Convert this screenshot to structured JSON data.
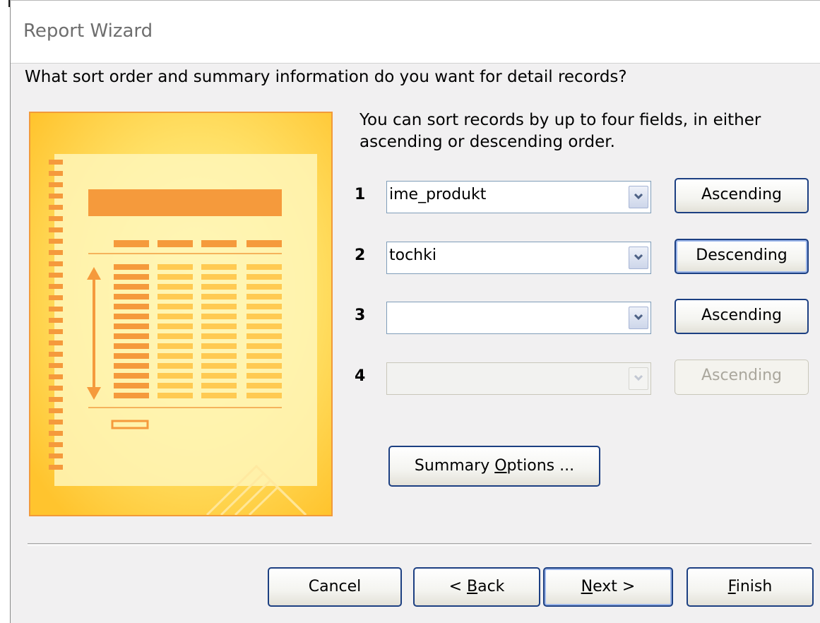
{
  "window": {
    "title": "Report Wizard"
  },
  "question": "What sort order and summary information do you want for detail records?",
  "instructions": "You can sort records by up to four fields, in either ascending or descending order.",
  "sort_rows": [
    {
      "number": "1",
      "field": "ime_produkt",
      "order": "Ascending",
      "enabled": true
    },
    {
      "number": "2",
      "field": "tochki",
      "order": "Descending",
      "enabled": true
    },
    {
      "number": "3",
      "field": "",
      "order": "Ascending",
      "enabled": true
    },
    {
      "number": "4",
      "field": "",
      "order": "Ascending",
      "enabled": false
    }
  ],
  "summary_button": {
    "prefix": "Summary ",
    "accel": "O",
    "suffix": "ptions ..."
  },
  "footer": {
    "cancel": "Cancel",
    "back": {
      "prefix": "< ",
      "accel": "B",
      "suffix": "ack"
    },
    "next": {
      "accel": "N",
      "suffix": "ext >"
    },
    "finish": {
      "accel": "F",
      "suffix": "inish"
    }
  },
  "colors": {
    "accent_border": "#1c3f82",
    "preview_frame": "#f29a3a",
    "preview_fill": "#ffd24a"
  },
  "icons": [
    "dropdown-arrow-icon",
    "report-preview-illustration"
  ]
}
